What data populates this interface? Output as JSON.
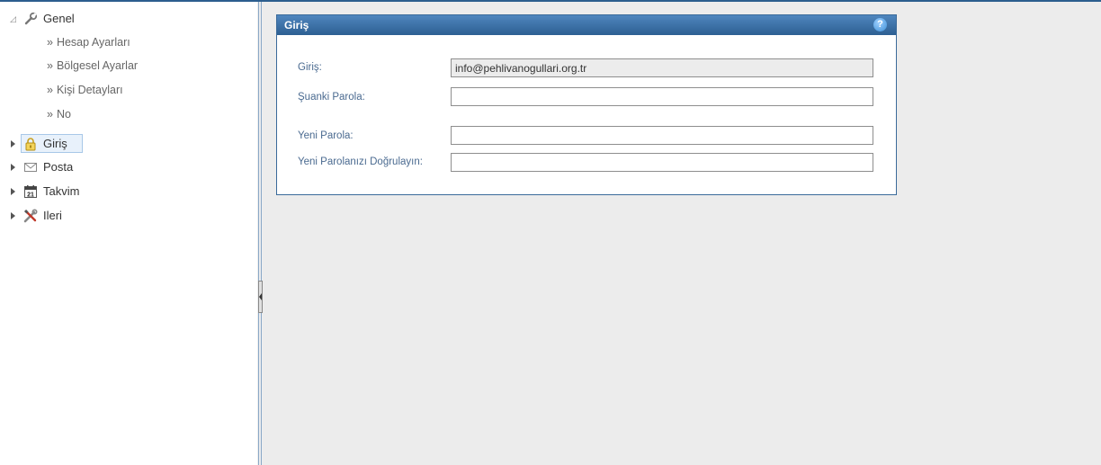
{
  "sidebar": {
    "genel": {
      "label": "Genel",
      "icon": "wrench-icon",
      "expanded": true,
      "children": [
        {
          "label": "Hesap Ayarları"
        },
        {
          "label": "Bölgesel Ayarlar"
        },
        {
          "label": "Kişi Detayları"
        },
        {
          "label": "No"
        }
      ]
    },
    "items": [
      {
        "label": "Giriş",
        "icon": "padlock-icon",
        "selected": true
      },
      {
        "label": "Posta",
        "icon": "envelope-icon"
      },
      {
        "label": "Takvim",
        "icon": "calendar-icon"
      },
      {
        "label": "Ileri",
        "icon": "tools-icon"
      }
    ],
    "calendar_day": "21",
    "subitem_prefix": "»"
  },
  "panel": {
    "title": "Giriş",
    "help_symbol": "?",
    "fields": [
      {
        "label": "Giriş:",
        "value": "info@pehlivanogullari.org.tr",
        "readonly": true
      },
      {
        "label": "Şuanki Parola:",
        "value": ""
      },
      {
        "label": "Yeni Parola:",
        "value": ""
      },
      {
        "label": "Yeni Parolanızı Doğrulayın:",
        "value": ""
      }
    ]
  },
  "colors": {
    "header_gradient_top": "#4f86be",
    "header_gradient_bottom": "#2d5f92",
    "label_color": "#4a6a90",
    "main_background": "#ececec"
  }
}
